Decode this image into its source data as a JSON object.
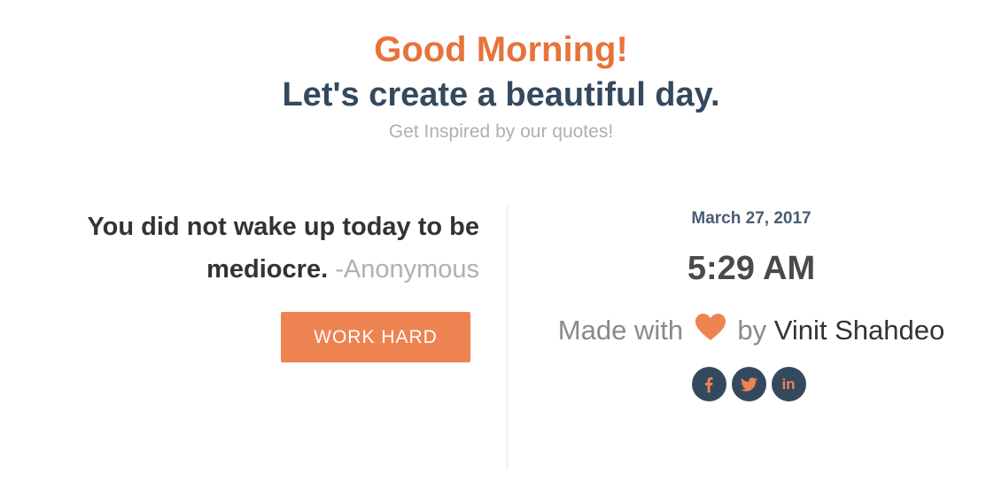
{
  "header": {
    "greeting": "Good Morning!",
    "tagline": "Let's create a beautiful day.",
    "subtitle": "Get Inspired by our quotes!"
  },
  "quote": {
    "text": "You did not wake up today to be mediocre.",
    "author": "-Anonymous",
    "button_label": "WORK HARD"
  },
  "clock": {
    "date": "March 27, 2017",
    "time": "5:29 AM"
  },
  "credit": {
    "prefix": "Made with",
    "heart_icon": "heart-icon",
    "joiner": "by",
    "author": "Vinit Shahdeo"
  },
  "social": {
    "facebook_icon": "facebook-icon",
    "twitter_icon": "twitter-icon",
    "linkedin_label": "in"
  },
  "colors": {
    "accent": "#ee8352",
    "greeting": "#e8733a",
    "dark": "#34495e",
    "muted": "#b0b0b0"
  }
}
